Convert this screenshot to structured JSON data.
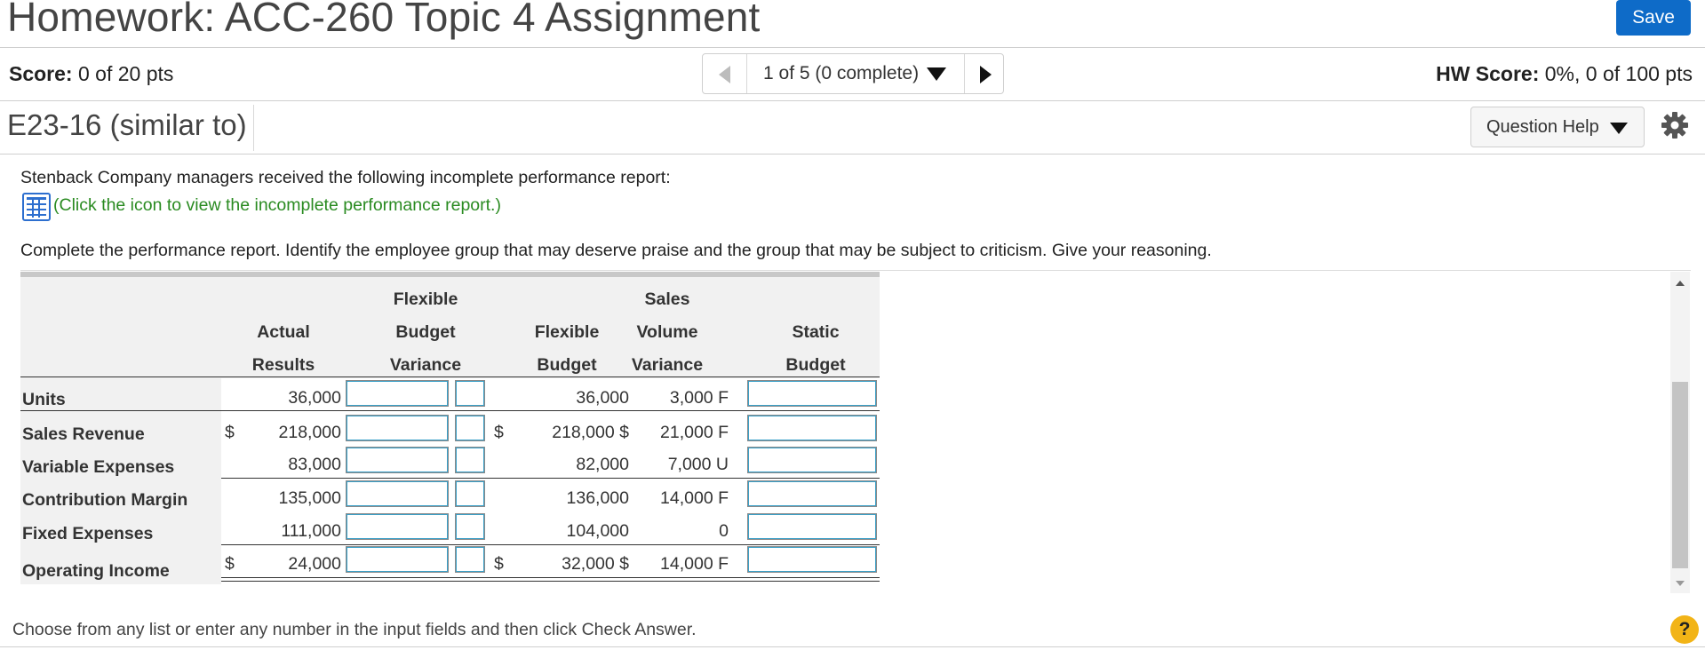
{
  "header": {
    "title": "Homework: ACC-260 Topic 4 Assignment",
    "save_label": "Save"
  },
  "score_bar": {
    "score_label": "Score:",
    "score_value": "0 of 20 pts",
    "pager_label": "1 of 5 (0 complete)",
    "hw_score_label": "HW Score:",
    "hw_score_value": "0%, 0 of 100 pts"
  },
  "question_bar": {
    "question_id": "E23-16 (similar to)",
    "help_label": "Question Help"
  },
  "question": {
    "intro": "Stenback Company managers received the following incomplete performance report:",
    "icon_link": "(Click the icon to view the incomplete performance report.)",
    "instruction": "Complete the performance report. Identify the employee group that may deserve praise and the group that may be subject to criticism. Give your reasoning."
  },
  "report": {
    "headers": {
      "actual_1": "Actual",
      "actual_2": "Results",
      "fbv_0": "Flexible",
      "fbv_1": "Budget",
      "fbv_2": "Variance",
      "fb_1": "Flexible",
      "fb_2": "Budget",
      "svv_0": "Sales",
      "svv_1": "Volume",
      "svv_2": "Variance",
      "static_1": "Static",
      "static_2": "Budget"
    },
    "currency_symbol": "$",
    "rows": [
      {
        "label": "Units",
        "actual": "36,000",
        "flexible_budget": "36,000",
        "sales_volume_variance": "3,000 F"
      },
      {
        "label": "Sales Revenue",
        "actual": "218,000",
        "flexible_budget": "218,000 $",
        "sales_volume_variance": "21,000 F"
      },
      {
        "label": "Variable Expenses",
        "actual": "83,000",
        "flexible_budget": "82,000",
        "sales_volume_variance": "7,000 U"
      },
      {
        "label": "Contribution Margin",
        "actual": "135,000",
        "flexible_budget": "136,000",
        "sales_volume_variance": "14,000 F"
      },
      {
        "label": "Fixed Expenses",
        "actual": "111,000",
        "flexible_budget": "104,000",
        "sales_volume_variance": "0"
      },
      {
        "label": "Operating Income",
        "actual": "24,000",
        "flexible_budget": "32,000 $",
        "sales_volume_variance": "14,000 F"
      }
    ]
  },
  "footer": {
    "instruction": "Choose from any list or enter any number in the input fields and then click Check Answer.",
    "help_symbol": "?"
  }
}
